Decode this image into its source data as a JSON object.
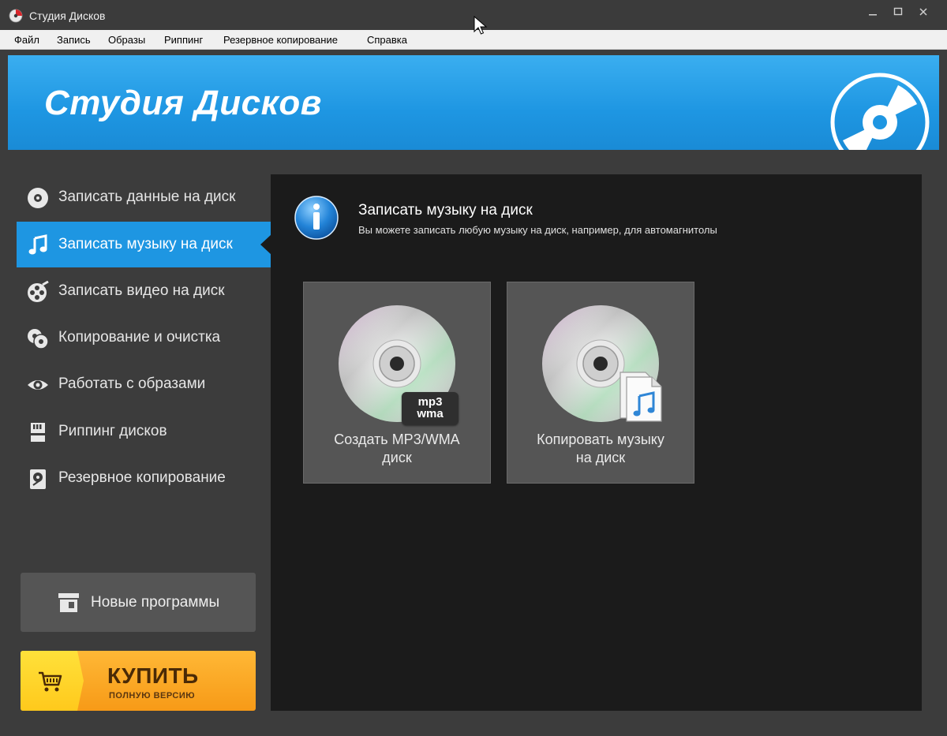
{
  "window": {
    "title": "Студия Дисков",
    "icon": "disc-app-icon",
    "controls": [
      "minimize-icon",
      "maximize-icon",
      "close-icon"
    ]
  },
  "menu": {
    "items": [
      "Файл",
      "Запись",
      "Образы",
      "Риппинг",
      "Резервное копирование",
      "Справка"
    ]
  },
  "banner": {
    "title": "Студия Дисков"
  },
  "sidebar": {
    "items": [
      {
        "label": "Записать данные на диск",
        "icon": "disc-icon",
        "active": false
      },
      {
        "label": "Записать музыку на диск",
        "icon": "music-note-icon",
        "active": true
      },
      {
        "label": "Записать видео на диск",
        "icon": "film-reel-icon",
        "active": false
      },
      {
        "label": "Копирование и очистка",
        "icon": "copy-discs-icon",
        "active": false
      },
      {
        "label": "Работать с образами",
        "icon": "eye-icon",
        "active": false
      },
      {
        "label": "Риппинг дисков",
        "icon": "sd-card-icon",
        "active": false
      },
      {
        "label": "Резервное копирование",
        "icon": "hard-drive-icon",
        "active": false
      }
    ],
    "new_programs": "Новые программы",
    "buy": {
      "main": "КУПИТЬ",
      "sub": "ПОЛНУЮ ВЕРСИЮ"
    }
  },
  "content": {
    "title": "Записать музыку на диск",
    "subtitle": "Вы можете записать любую музыку на диск, например, для автомагнитолы",
    "tiles": [
      {
        "label_line1": "Создать MP3/WMA",
        "label_line2": "диск",
        "badge_line1": "mp3",
        "badge_line2": "wma"
      },
      {
        "label_line1": "Копировать музыку",
        "label_line2": "на диск"
      }
    ]
  },
  "colors": {
    "accent": "#1e96e2",
    "banner_top": "#3aaef0",
    "sidebar_bg": "#3c3c3c",
    "content_bg": "#1b1b1b",
    "tile_bg": "#555555",
    "buy_orange": "#f79a17",
    "buy_yellow": "#ffd82a"
  }
}
